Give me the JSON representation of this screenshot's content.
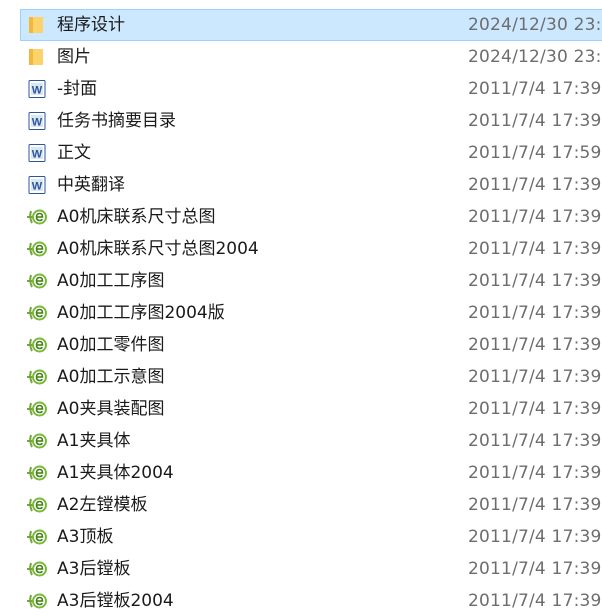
{
  "files": [
    {
      "name": "程序设计",
      "date": "2024/12/30 23:",
      "icon": "folder-icon",
      "selected": true
    },
    {
      "name": "图片",
      "date": "2024/12/30 23:",
      "icon": "folder-icon",
      "selected": false
    },
    {
      "name": "-封面",
      "date": "2011/7/4 17:39",
      "icon": "word-doc-icon",
      "selected": false
    },
    {
      "name": "任务书摘要目录",
      "date": "2011/7/4 17:39",
      "icon": "word-doc-icon",
      "selected": false
    },
    {
      "name": "正文",
      "date": "2011/7/4 17:59",
      "icon": "word-doc-icon",
      "selected": false
    },
    {
      "name": "中英翻译",
      "date": "2011/7/4 17:39",
      "icon": "word-doc-icon",
      "selected": false
    },
    {
      "name": "A0机床联系尺寸总图",
      "date": "2011/7/4 17:39",
      "icon": "cad-drawing-icon",
      "selected": false
    },
    {
      "name": "A0机床联系尺寸总图2004",
      "date": "2011/7/4 17:39",
      "icon": "cad-drawing-icon",
      "selected": false
    },
    {
      "name": "A0加工工序图",
      "date": "2011/7/4 17:39",
      "icon": "cad-drawing-icon",
      "selected": false
    },
    {
      "name": "A0加工工序图2004版",
      "date": "2011/7/4 17:39",
      "icon": "cad-drawing-icon",
      "selected": false
    },
    {
      "name": "A0加工零件图",
      "date": "2011/7/4 17:39",
      "icon": "cad-drawing-icon",
      "selected": false
    },
    {
      "name": "A0加工示意图",
      "date": "2011/7/4 17:39",
      "icon": "cad-drawing-icon",
      "selected": false
    },
    {
      "name": "A0夹具装配图",
      "date": "2011/7/4 17:39",
      "icon": "cad-drawing-icon",
      "selected": false
    },
    {
      "name": "A1夹具体",
      "date": "2011/7/4 17:39",
      "icon": "cad-drawing-icon",
      "selected": false
    },
    {
      "name": "A1夹具体2004",
      "date": "2011/7/4 17:39",
      "icon": "cad-drawing-icon",
      "selected": false
    },
    {
      "name": "A2左镗模板",
      "date": "2011/7/4 17:39",
      "icon": "cad-drawing-icon",
      "selected": false
    },
    {
      "name": "A3顶板",
      "date": "2011/7/4 17:39",
      "icon": "cad-drawing-icon",
      "selected": false
    },
    {
      "name": "A3后镗板",
      "date": "2011/7/4 17:39",
      "icon": "cad-drawing-icon",
      "selected": false
    },
    {
      "name": "A3后镗板2004",
      "date": "2011/7/4 17:39",
      "icon": "cad-drawing-icon",
      "selected": false
    }
  ],
  "colors": {
    "selection_fill": "#cce8ff",
    "selection_border": "#99d1ff",
    "folder": "#f8c84c",
    "word_blue": "#2b5797",
    "cad_green": "#7ab83a"
  }
}
